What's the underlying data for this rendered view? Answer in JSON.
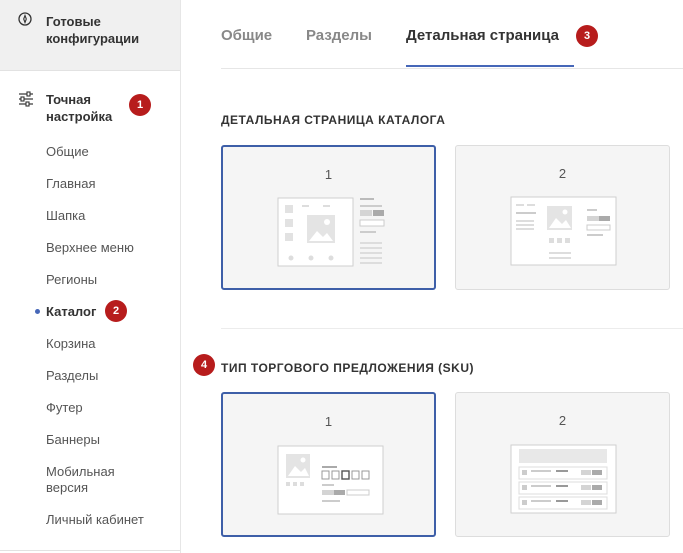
{
  "sidebar": {
    "ready_configs_label": "Готовые конфигурации",
    "fine_tuning_label": "Точная настройка",
    "fine_tuning_badge": "1",
    "items": [
      {
        "label": "Общие"
      },
      {
        "label": "Главная"
      },
      {
        "label": "Шапка"
      },
      {
        "label": "Верхнее меню"
      },
      {
        "label": "Регионы"
      },
      {
        "label": "Каталог",
        "active": true,
        "badge": "2"
      },
      {
        "label": "Корзина"
      },
      {
        "label": "Разделы"
      },
      {
        "label": "Футер"
      },
      {
        "label": "Баннеры"
      },
      {
        "label": "Мобильная версия"
      },
      {
        "label": "Личный кабинет"
      }
    ],
    "icons": {
      "ready": "compass-icon",
      "fine": "sliders-icon"
    }
  },
  "tabs": {
    "items": [
      {
        "label": "Общие"
      },
      {
        "label": "Разделы"
      },
      {
        "label": "Детальная страница",
        "active": true,
        "badge": "3"
      }
    ]
  },
  "sections": {
    "detail": {
      "title": "ДЕТАЛЬНАЯ СТРАНИЦА КАТАЛОГА",
      "options": [
        {
          "label": "1",
          "selected": true
        },
        {
          "label": "2",
          "selected": false
        }
      ]
    },
    "sku": {
      "title": "ТИП ТОРГОВОГО ПРЕДЛОЖЕНИЯ (SKU)",
      "badge": "4",
      "options": [
        {
          "label": "1",
          "selected": true
        },
        {
          "label": "2",
          "selected": false
        }
      ]
    }
  },
  "colors": {
    "accent": "#3e5fa8",
    "badge": "#b71c1c",
    "sidebar_active_bg": "#f0f0f0"
  }
}
